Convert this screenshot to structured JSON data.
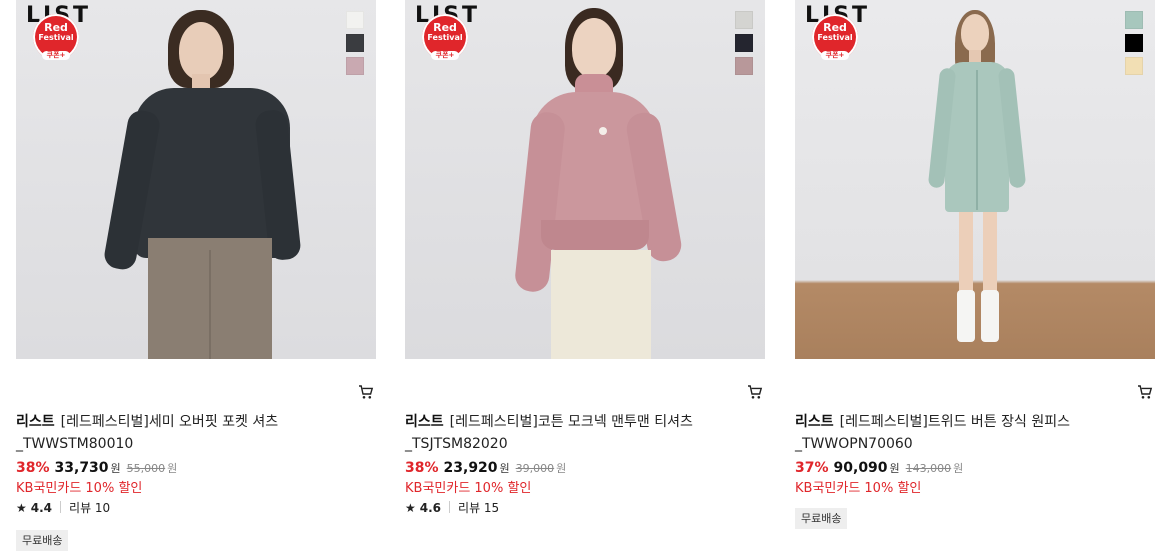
{
  "products": [
    {
      "logo": "LIST",
      "badge": {
        "line1": "Red",
        "line2": "Festival",
        "coupon": "쿠폰+"
      },
      "swatches": [
        "#f2f2f0",
        "#3a3c40",
        "#c9a9b1"
      ],
      "brand": "리스트",
      "title": "[레드페스티벌]세미 오버핏 포켓 셔츠 _TWWSTM80010",
      "discount": "38%",
      "price": "33,730",
      "currency": "원",
      "original_price": "55,000",
      "card_promo": "KB국민카드 10% 할인",
      "rating": "4.4",
      "review_label": "리뷰 10",
      "shipping": "무료배송",
      "icons": {
        "cart": "cart-icon",
        "star": "star-icon"
      }
    },
    {
      "logo": "LIST",
      "badge": {
        "line1": "Red",
        "line2": "Festival",
        "coupon": "쿠폰+"
      },
      "swatches": [
        "#d4d4d1",
        "#24252f",
        "#b8989a"
      ],
      "brand": "리스트",
      "title": "[레드페스티벌]코튼 모크넥 맨투맨 티셔츠 _TSJTSM82020",
      "discount": "38%",
      "price": "23,920",
      "currency": "원",
      "original_price": "39,000",
      "card_promo": "KB국민카드 10% 할인",
      "rating": "4.6",
      "review_label": "리뷰 15",
      "shipping": "",
      "icons": {
        "cart": "cart-icon",
        "star": "star-icon"
      }
    },
    {
      "logo": "LIST",
      "badge": {
        "line1": "Red",
        "line2": "Festival",
        "coupon": "쿠폰+"
      },
      "swatches": [
        "#a7c7bd",
        "#000000",
        "#f2dfb4"
      ],
      "brand": "리스트",
      "title": "[레드페스티벌]트위드 버튼 장식 원피스 _TWWOPN70060",
      "discount": "37%",
      "price": "90,090",
      "currency": "원",
      "original_price": "143,000",
      "card_promo": "KB국민카드 10% 할인",
      "rating": "",
      "review_label": "",
      "shipping": "무료배송",
      "icons": {
        "cart": "cart-icon",
        "star": "star-icon"
      }
    }
  ],
  "colors": {
    "accent": "#e0262b",
    "text": "#111111",
    "muted": "#888888"
  }
}
